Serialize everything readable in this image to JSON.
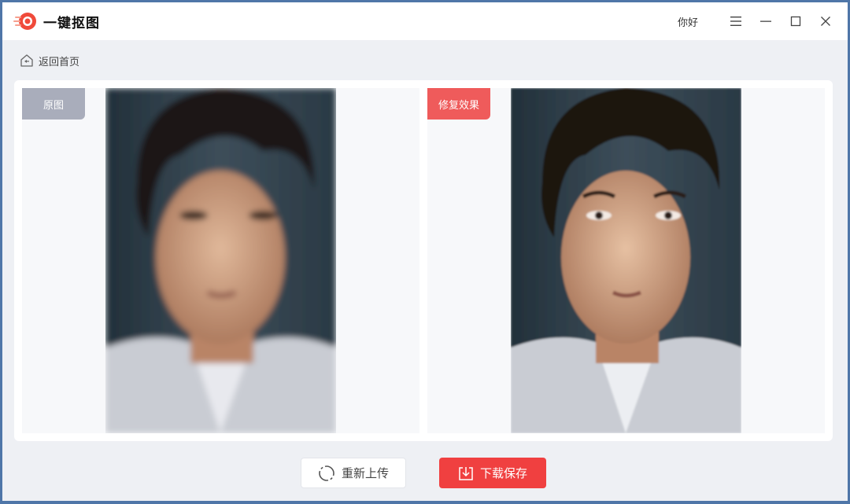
{
  "app": {
    "title": "一键抠图",
    "greeting": "你好",
    "colors": {
      "accent": "#f04040",
      "tag_original": "#a9adbb",
      "tag_result": "#ef5b5b"
    }
  },
  "titlebar": {
    "controls": [
      "menu-icon",
      "minimize-icon",
      "maximize-icon",
      "close-icon"
    ]
  },
  "nav": {
    "back_label": "返回首页"
  },
  "compare": {
    "original_label": "原图",
    "result_label": "修复效果"
  },
  "actions": {
    "reupload_label": "重新上传",
    "download_label": "下载保存"
  }
}
